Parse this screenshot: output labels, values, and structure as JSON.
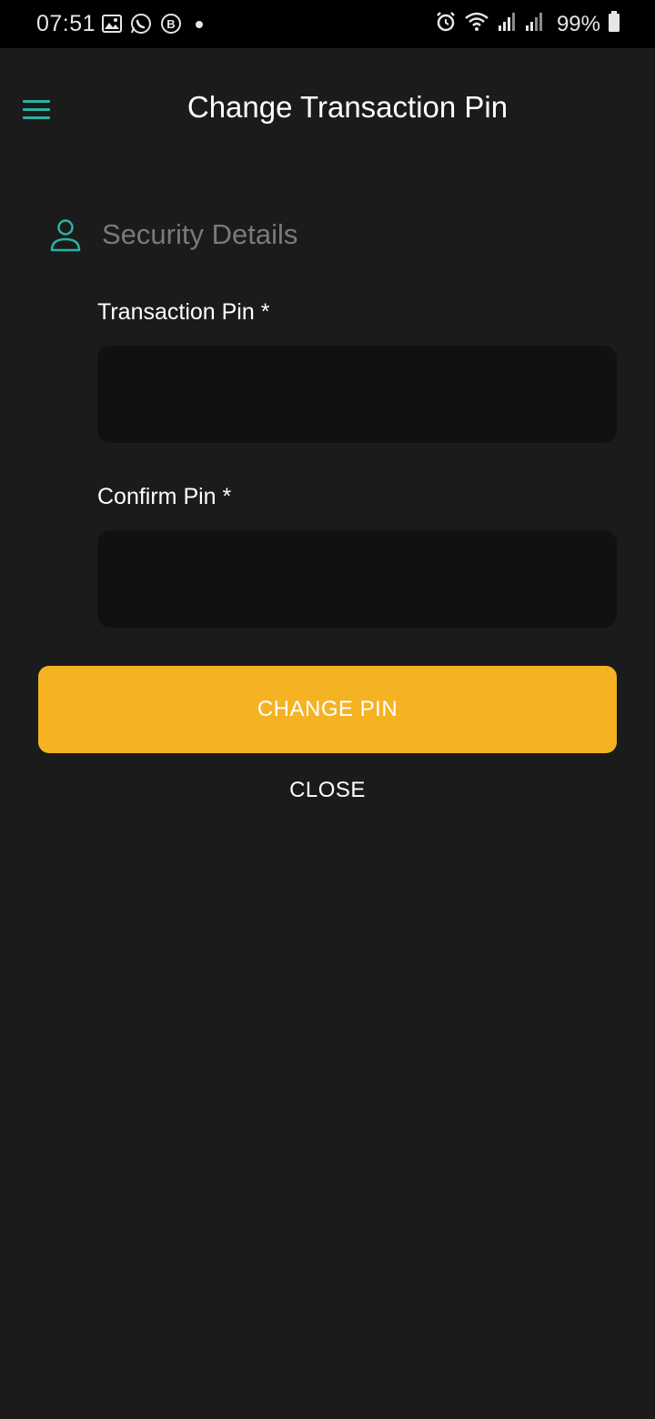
{
  "status_bar": {
    "time": "07:51",
    "battery_percent": "99%",
    "icons_left": [
      "gallery-icon",
      "whatsapp-icon",
      "b-badge-icon",
      "dot-icon"
    ],
    "icons_right": [
      "alarm-icon",
      "wifi-icon",
      "signal-icon",
      "signal-icon",
      "battery-icon"
    ]
  },
  "header": {
    "title": "Change Transaction Pin",
    "menu_icon": "hamburger-menu-icon"
  },
  "section": {
    "title": "Security Details",
    "icon": "user-icon"
  },
  "form": {
    "transaction_pin_label": "Transaction Pin *",
    "transaction_pin_value": "",
    "confirm_pin_label": "Confirm Pin *",
    "confirm_pin_value": ""
  },
  "actions": {
    "change_pin_label": "CHANGE PIN",
    "close_label": "CLOSE"
  },
  "colors": {
    "background": "#1b1b1b",
    "accent": "#2bb3a3",
    "primary_button": "#f5b223",
    "input_background": "#111111",
    "muted_text": "#7a7a7a"
  }
}
